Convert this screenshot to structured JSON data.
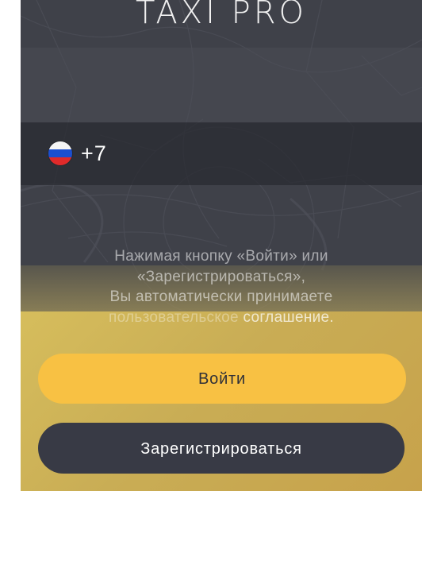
{
  "logo": {
    "text": "TAXI PRO"
  },
  "phone": {
    "country_flag": "russia-flag",
    "country_code": "+7"
  },
  "agreement": {
    "line1": "Нажимая кнопку «Войти» или",
    "line2": "«Зарегистрироваться»,",
    "line3": "Вы автоматически принимаете",
    "link_part1": "пользовательское",
    "link_part2": "соглашение."
  },
  "buttons": {
    "login_label": "Войти",
    "register_label": "Зарегистрироваться"
  },
  "colors": {
    "background": "#3e4048",
    "accent_yellow": "#f8c143",
    "dark_button": "#383a45",
    "gold_panel": "#c9ad55"
  }
}
